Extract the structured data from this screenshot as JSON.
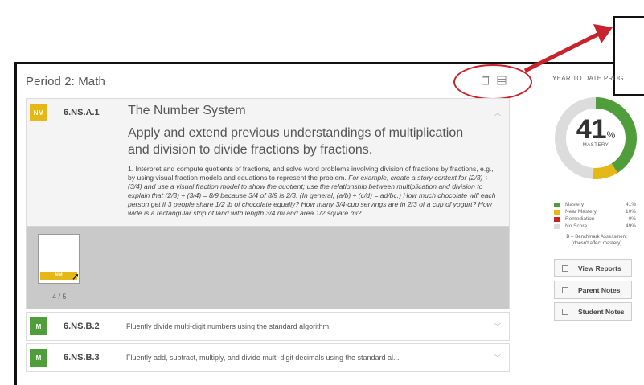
{
  "header": {
    "title": "Period 2: Math"
  },
  "standards": [
    {
      "badge": "NM",
      "code": "6.NS.A.1",
      "domain": "The Number System",
      "cluster": "Apply and extend previous understandings of multiplication and division to divide fractions by fractions.",
      "description_plain": "1. Interpret and compute quotients of fractions, and solve word problems involving division of fractions by fractions, e.g., by using visual fraction models and equations to represent the problem. ",
      "description_italic": "For example, create a story context for (2/3) ÷ (3/4) and use a visual fraction model to show the quotient; use the relationship between multiplication and division to explain that (2/3) ÷ (3/4) = 8/9 because 3/4 of 8/9 is 2/3. (In general, (a/b) ÷ (c/d) = ad/bc.) How much chocolate will each person get if 3 people share 1/2 lb of chocolate equally? How many 3/4-cup servings are in 2/3 of a cup of yogurt? How wide is a rectangular strip of land with length 3/4 mi and area 1/2 square mi?",
      "thumb_badge": "NM",
      "thumb_count": "4 / 5"
    },
    {
      "badge": "M",
      "code": "6.NS.B.2",
      "text": "Fluently divide multi-digit numbers using the standard algorithm."
    },
    {
      "badge": "M",
      "code": "6.NS.B.3",
      "text": "Fluently add, subtract, multiply, and divide multi-digit decimals using the standard al..."
    }
  ],
  "progress": {
    "label": "YEAR TO DATE PROG",
    "percent": "41",
    "percent_sign": "%",
    "mastery_label": "MASTERY",
    "legend": [
      {
        "name": "Mastery",
        "value": "41%",
        "color": "#4f9e3b"
      },
      {
        "name": "Near Mastery",
        "value": "10%",
        "color": "#e5b817"
      },
      {
        "name": "Remediation",
        "value": "0%",
        "color": "#c8232c"
      },
      {
        "name": "No Score",
        "value": "49%",
        "color": "#dcdcdc"
      }
    ],
    "note_line1": "B = Benchmark Assessment",
    "note_line2": "(doesn't affect mastery)"
  },
  "buttons": {
    "view_reports": "View Reports",
    "parent_notes": "Parent Notes",
    "student_notes": "Student Notes"
  },
  "colors": {
    "mastery": "#4f9e3b",
    "near_mastery": "#e5b817",
    "no_score": "#dcdcdc",
    "annotation_red": "#c8232c"
  }
}
